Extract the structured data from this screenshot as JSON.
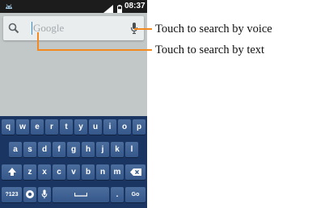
{
  "status_bar": {
    "time": "08:37",
    "notification_icon": "android-icon",
    "signal_icon": "signal-icon",
    "battery_icon": "battery-icon"
  },
  "search_widget": {
    "placeholder": "Google",
    "search_icon": "magnifier-icon",
    "voice_icon": "microphone-icon"
  },
  "keyboard": {
    "row1": [
      "q",
      "w",
      "e",
      "r",
      "t",
      "y",
      "u",
      "i",
      "o",
      "p"
    ],
    "row2": [
      "a",
      "s",
      "d",
      "f",
      "g",
      "h",
      "j",
      "k",
      "l"
    ],
    "row3": [
      "z",
      "x",
      "c",
      "v",
      "b",
      "n",
      "m"
    ],
    "shift_icon": "shift-icon",
    "delete_icon": "backspace-icon",
    "symbols_label": "?123",
    "settings_icon": "settings-icon",
    "mic_icon": "microphone-icon",
    "space_icon": "space-icon",
    "period_label": ".",
    "go_label": "Go"
  },
  "callouts": {
    "voice": "Touch to search by voice",
    "text": "Touch to search by text"
  },
  "colors": {
    "callout_line": "#f4891f",
    "keyboard_bg": "#1b3562",
    "key_face": "#3f6294",
    "screen_bg": "#c2c7c8",
    "status_bar": "#1c1c1c"
  }
}
